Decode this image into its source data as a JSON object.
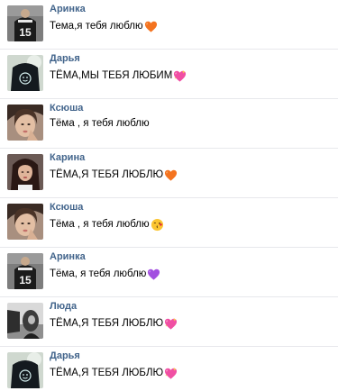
{
  "messages": [
    {
      "name": "Аринка",
      "text": "Тема,я тебя люблю",
      "emoji": "orange-heart-icon",
      "avatar": "hoodie-15"
    },
    {
      "name": "Дарья",
      "text": "ТЁМА,МЫ ТЕБЯ ЛЮБИМ",
      "emoji": "sparkling-heart-icon",
      "avatar": "smiley-shirt"
    },
    {
      "name": "Ксюша",
      "text": "Тёма , я тебя люблю",
      "emoji": "",
      "avatar": "selfie"
    },
    {
      "name": "Карина",
      "text": "ТЁМА,Я ТЕБЯ ЛЮБЛЮ",
      "emoji": "orange-heart-icon",
      "avatar": "dark-hair"
    },
    {
      "name": "Ксюша",
      "text": "Тёма , я тебя люблю",
      "emoji": "kiss-face-icon",
      "avatar": "selfie"
    },
    {
      "name": "Аринка",
      "text": "Тёма, я тебя люблю",
      "emoji": "purple-heart-icon",
      "avatar": "hoodie-15"
    },
    {
      "name": "Люда",
      "text": "ТЁМА,Я ТЕБЯ ЛЮБЛЮ",
      "emoji": "sparkling-heart-icon",
      "avatar": "bw-photo"
    },
    {
      "name": "Дарья",
      "text": "ТЁМА,Я ТЕБЯ ЛЮБЛЮ",
      "emoji": "sparkling-heart-icon",
      "avatar": "smiley-shirt"
    }
  ],
  "colors": {
    "name": "#42648b",
    "text": "#000000",
    "divider": "#e7e8ec"
  }
}
